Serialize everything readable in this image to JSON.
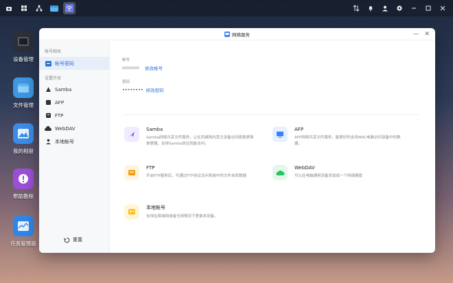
{
  "window": {
    "title": "网络服务"
  },
  "sidebar": {
    "section_account": "帐号相关",
    "account_item": "帐号密码",
    "section_services": "设置开关",
    "items": [
      {
        "label": "Samba",
        "icon": "samba-icon"
      },
      {
        "label": "AFP",
        "icon": "afp-icon"
      },
      {
        "label": "FTP",
        "icon": "ftp-icon"
      },
      {
        "label": "WebDAV",
        "icon": "webdav-icon"
      },
      {
        "label": "本地帐号",
        "icon": "local-account-icon"
      }
    ],
    "reset_label": "重置"
  },
  "account": {
    "account_label": "帐号",
    "edit_account": "修改帐号",
    "password_label": "密码",
    "password_value": "••••••••",
    "edit_password": "修改密码"
  },
  "services": [
    {
      "title": "Samba",
      "desc": "Samba网络共享文件服务，让在同城网内其它设备访问极致更简单便捷，支持Samba协议就能访问。"
    },
    {
      "title": "AFP",
      "desc": "AFP网络共享文件服务，能更好的支持MAC电脑访问设备中的数据。"
    },
    {
      "title": "FTP",
      "desc": "开启FTP服务后，可通过FTP协议访问系统中的文件夹和数据"
    },
    {
      "title": "WebDAV",
      "desc": "可以在电脑通用设备添加成一个网络硬盘"
    },
    {
      "title": "本地帐号",
      "desc": "支持在局域网或者无网情况下登录本设备。"
    }
  ],
  "desktop": [
    {
      "label": "设备管理"
    },
    {
      "label": "文件管理"
    },
    {
      "label": "我的相册"
    },
    {
      "label": "帮助教程"
    },
    {
      "label": "任务管理器"
    }
  ],
  "colors": {
    "accent": "#2f6fd8",
    "samba": "#8b5cf6",
    "afp": "#3b82f6",
    "ftp": "#f59e0b",
    "webdav": "#22c55e",
    "local": "#fbbf24"
  }
}
